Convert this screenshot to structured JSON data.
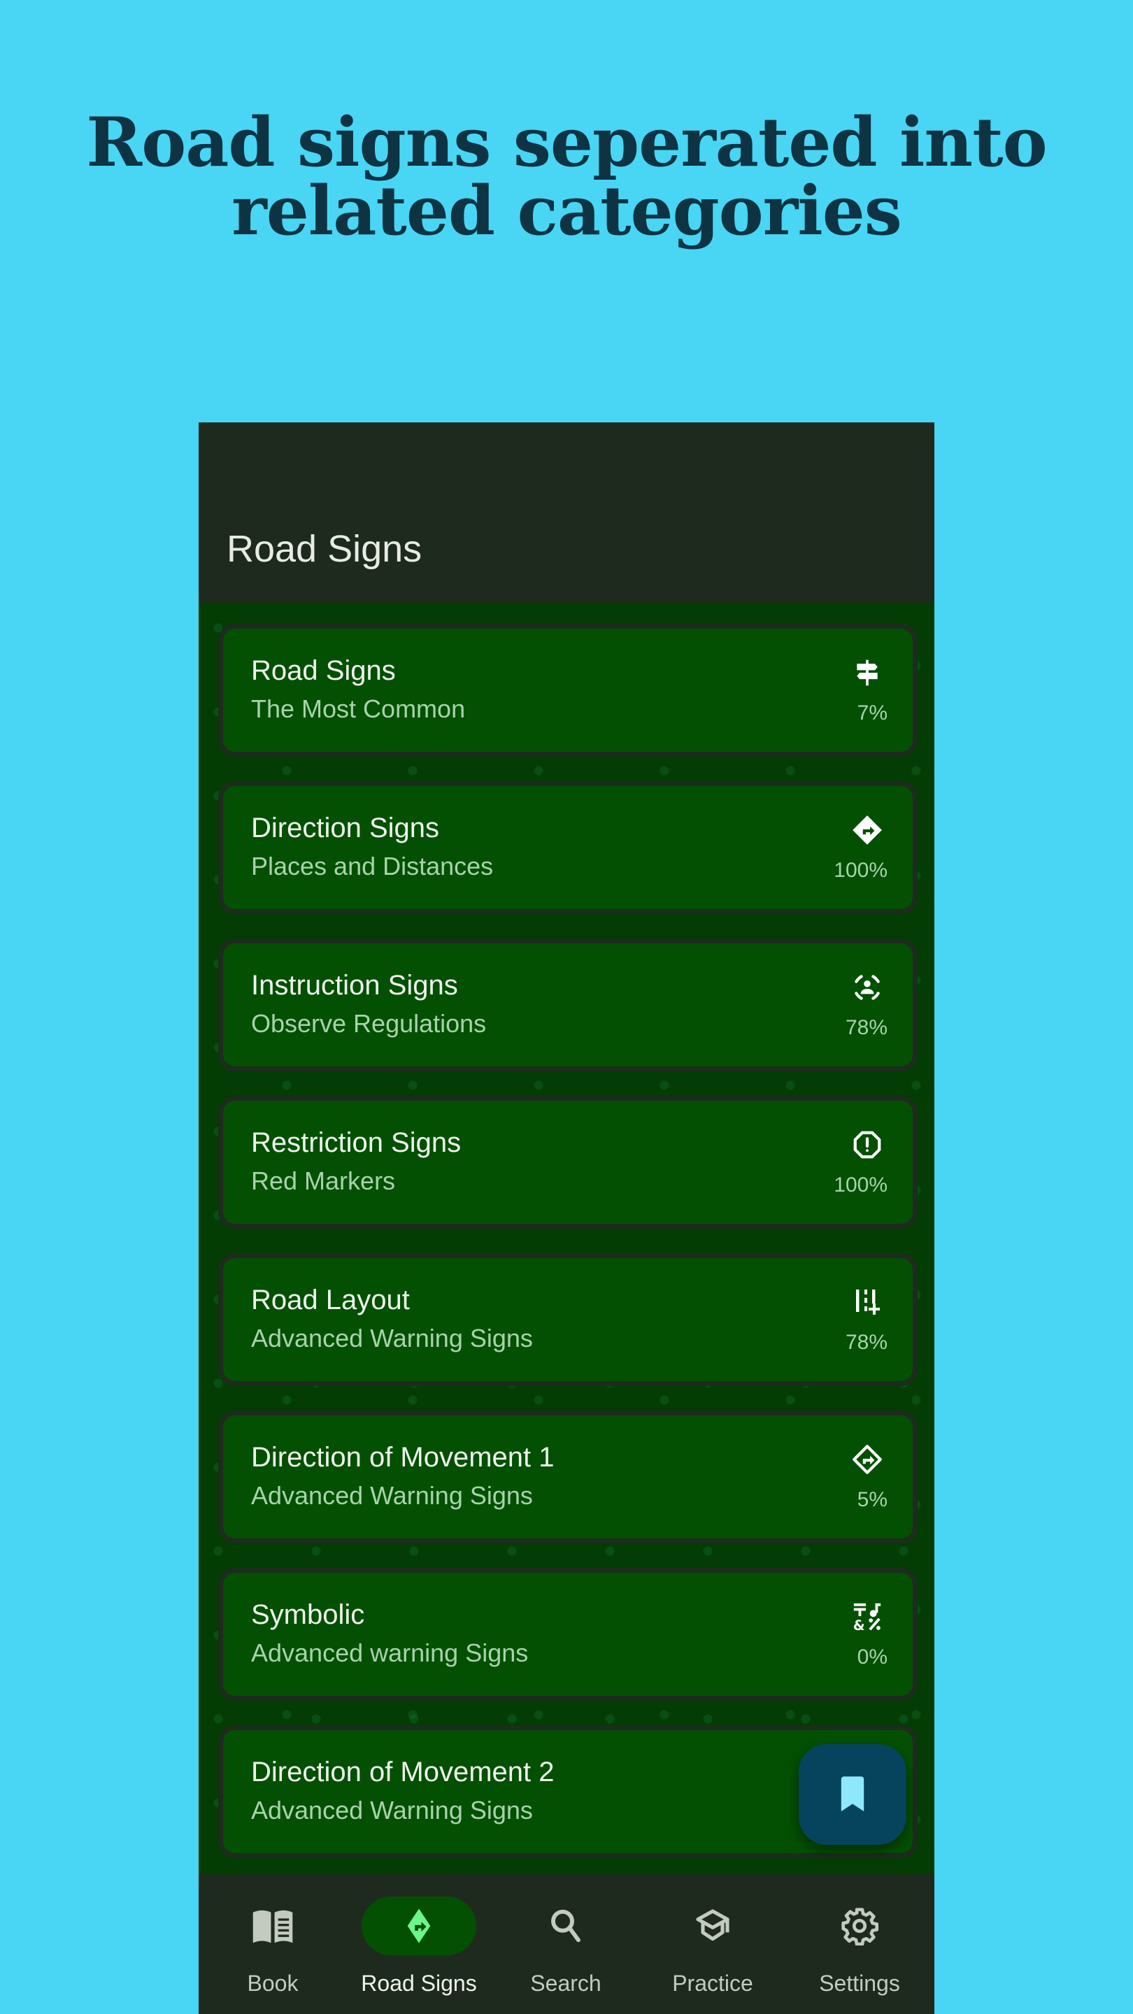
{
  "headline": {
    "line1": "Road signs seperated into",
    "line2": "related categories"
  },
  "colors": {
    "background": "#48d6f4",
    "headline": "#0e3444",
    "appbar": "#1f2a1f",
    "card": "#035003",
    "card_border": "#1e2b1e",
    "accent": "#6cf58a",
    "fab": "#05445c",
    "fab_icon": "#8ee8fb"
  },
  "appbar": {
    "title": "Road Signs"
  },
  "categories": [
    {
      "title": "Road Signs",
      "subtitle": "The Most Common",
      "progress": "7%",
      "icon": "signpost-icon"
    },
    {
      "title": "Direction Signs",
      "subtitle": "Places and Distances",
      "progress": "100%",
      "icon": "directions-diamond-icon"
    },
    {
      "title": "Instruction Signs",
      "subtitle": "Observe Regulations",
      "progress": "78%",
      "icon": "person-focus-icon"
    },
    {
      "title": "Restriction Signs",
      "subtitle": "Red Markers",
      "progress": "100%",
      "icon": "octagon-alert-icon"
    },
    {
      "title": "Road Layout",
      "subtitle": "Advanced Warning Signs",
      "progress": "78%",
      "icon": "lanes-add-icon"
    },
    {
      "title": "Direction of Movement 1",
      "subtitle": "Advanced Warning Signs",
      "progress": "5%",
      "icon": "directions-outline-icon"
    },
    {
      "title": "Symbolic",
      "subtitle": "Advanced warning Signs",
      "progress": "0%",
      "icon": "symbols-icon"
    },
    {
      "title": "Direction of Movement 2",
      "subtitle": "Advanced Warning Signs",
      "progress": "",
      "icon": ""
    }
  ],
  "fab": {
    "icon": "bookmark-icon"
  },
  "nav": [
    {
      "label": "Book",
      "icon": "book-icon",
      "active": false
    },
    {
      "label": "Road Signs",
      "icon": "directions-diamond-icon",
      "active": true
    },
    {
      "label": "Search",
      "icon": "search-icon",
      "active": false
    },
    {
      "label": "Practice",
      "icon": "graduation-cap-icon",
      "active": false
    },
    {
      "label": "Settings",
      "icon": "gear-icon",
      "active": false
    }
  ]
}
